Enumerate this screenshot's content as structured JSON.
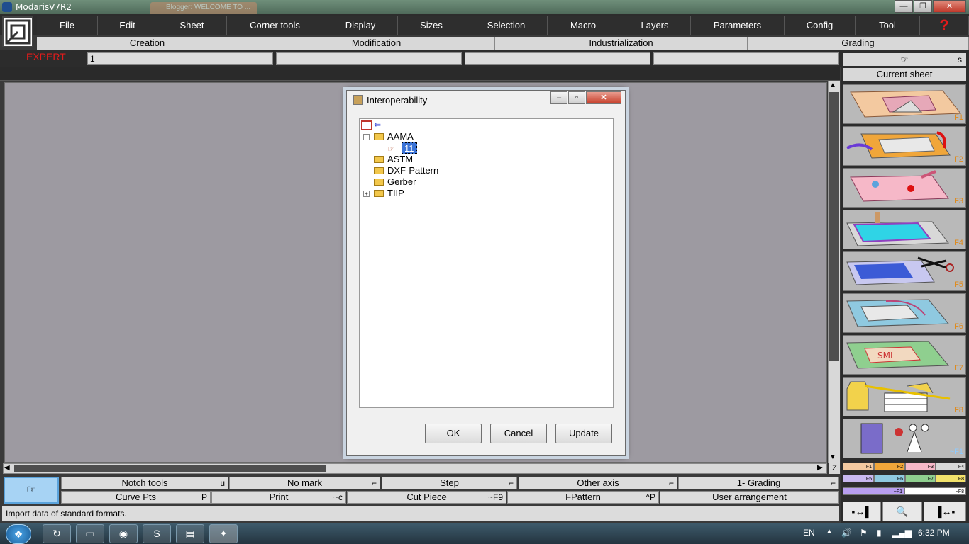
{
  "window": {
    "title": "ModarisV7R2",
    "bg_tab": "Blogger: WELCOME TO ..."
  },
  "window_controls": {
    "minimize": "—",
    "restore": "❐",
    "close": "✕"
  },
  "menu": [
    "File",
    "Edit",
    "Sheet",
    "Corner tools",
    "Display",
    "Sizes",
    "Selection",
    "Macro",
    "Layers",
    "Parameters",
    "Config",
    "Tool"
  ],
  "help_label": "?",
  "submenu": [
    "Creation",
    "Modification",
    "Industrialization",
    "Grading"
  ],
  "mode": {
    "expert": "EXPERT",
    "field1": "1"
  },
  "right_panel": {
    "corner_label": "s",
    "current_sheet": "Current sheet",
    "fkeys": [
      "F1",
      "F2",
      "F3",
      "F4",
      "F5",
      "F6",
      "F7",
      "F8",
      "~F1"
    ],
    "swatches_row1": [
      "F1",
      "F2",
      "F3",
      "F4"
    ],
    "swatches_row2": [
      "F5",
      "F6",
      "F7",
      "F8"
    ],
    "swatches_row3": [
      "~F1",
      "~F8"
    ]
  },
  "toolbar": {
    "row1": [
      {
        "label": "Notch tools",
        "key": "u"
      },
      {
        "label": "No mark",
        "key": "⌐"
      },
      {
        "label": "Step",
        "key": "⌐"
      },
      {
        "label": "Other axis",
        "key": "⌐"
      },
      {
        "label": "1- Grading",
        "key": "⌐"
      }
    ],
    "row2": [
      {
        "label": "Curve Pts",
        "key": "P"
      },
      {
        "label": "Print",
        "key": "~c"
      },
      {
        "label": "Cut Piece",
        "key": "~F9"
      },
      {
        "label": "FPattern",
        "key": "^P"
      },
      {
        "label": "User arrangement",
        "key": ""
      }
    ]
  },
  "status_text": "Import data of standard formats.",
  "bottom_right_buttons": [
    "▪↔▌",
    "🔍",
    "⇔",
    "▐↔▪"
  ],
  "taskbar": {
    "lang": "EN",
    "time": "6:32 PM"
  },
  "dialog": {
    "title": "Interoperability",
    "tree": {
      "root_icon": "modaris-logo",
      "items": [
        {
          "label": "AAMA",
          "expanded": true,
          "children": [
            "11"
          ]
        },
        {
          "label": "ASTM"
        },
        {
          "label": "DXF-Pattern"
        },
        {
          "label": "Gerber"
        },
        {
          "label": "TIIP",
          "expandable": true
        }
      ]
    },
    "buttons": {
      "ok": "OK",
      "cancel": "Cancel",
      "update": "Update"
    }
  }
}
